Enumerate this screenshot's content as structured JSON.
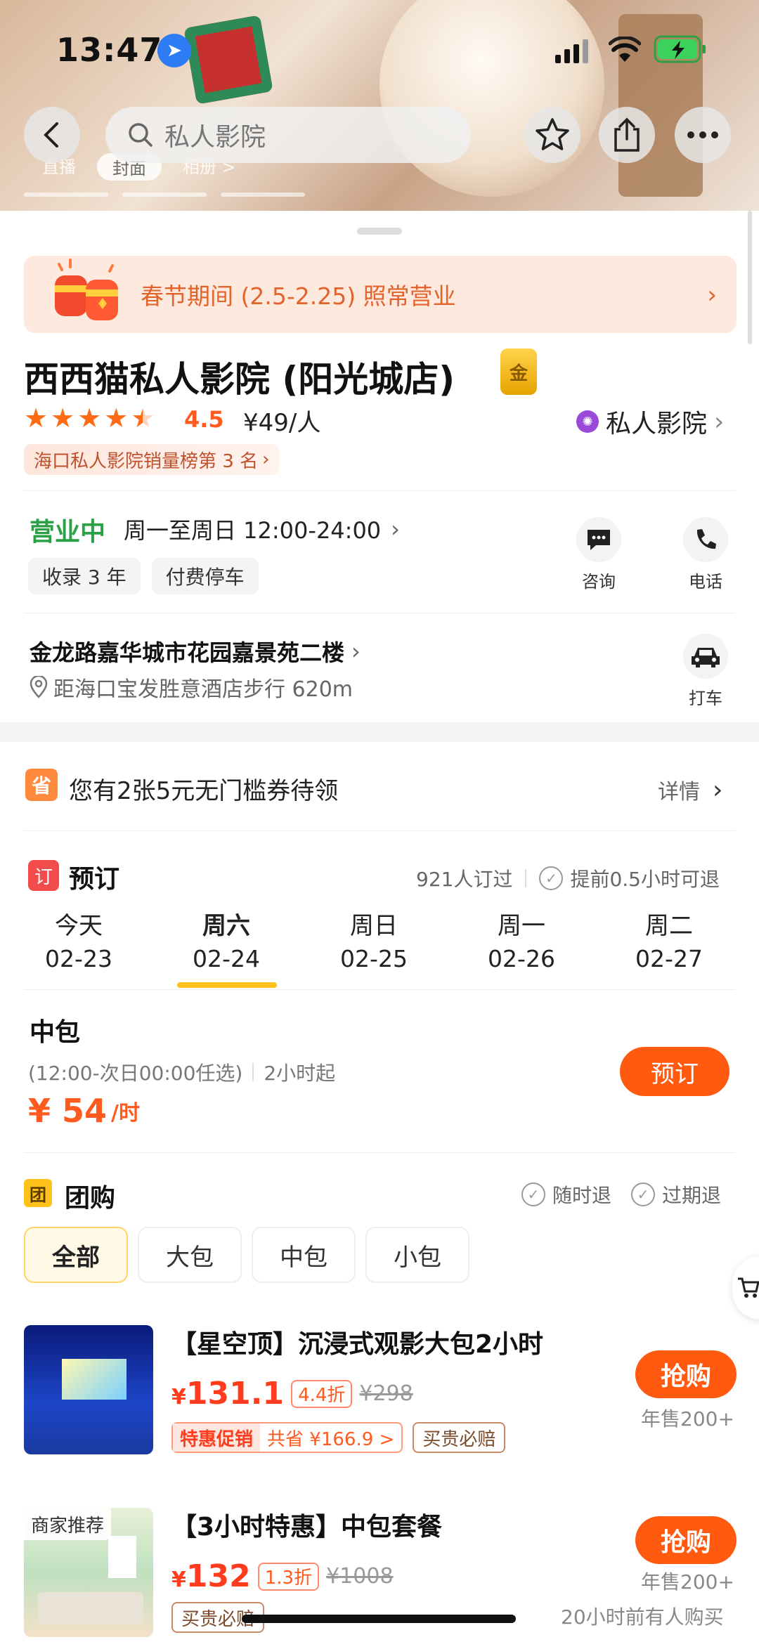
{
  "status_bar": {
    "time": "13:47"
  },
  "nav": {
    "search_placeholder": "私人影院"
  },
  "hero": {
    "tabs": [
      "直播",
      "封面",
      "相册 >"
    ]
  },
  "banner": {
    "text": "春节期间 (2.5-2.25) 照常营业"
  },
  "shop": {
    "name": "西西猫私人影院 (阳光城店)",
    "gold_badge": "金",
    "rating": "4.5",
    "rating_value": 4.5,
    "price_per_person": "¥49/人",
    "category": "私人影院",
    "rank": "海口私人影院销量榜第 3 名"
  },
  "hours": {
    "status": "营业中",
    "time": "周一至周日 12:00-24:00",
    "tags": [
      "收录 3 年",
      "付费停车"
    ],
    "actions": [
      {
        "label": "咨询",
        "icon": "chat-icon"
      },
      {
        "label": "电话",
        "icon": "phone-icon"
      }
    ]
  },
  "address": {
    "street": "金龙路嘉华城市花园嘉景苑二楼",
    "distance": "距海口宝发胜意酒店步行 620m",
    "taxi_label": "打车"
  },
  "coupon": {
    "icon_text": "省",
    "text": "您有2张5元无门槛券待领",
    "detail": "详情"
  },
  "booking": {
    "icon_text": "订",
    "title": "预订",
    "count": "921人订过",
    "advance": "提前0.5小时可退",
    "dates": [
      {
        "day": "今天",
        "date": "02-23"
      },
      {
        "day": "周六",
        "date": "02-24"
      },
      {
        "day": "周日",
        "date": "02-25"
      },
      {
        "day": "周一",
        "date": "02-26"
      },
      {
        "day": "周二",
        "date": "02-27"
      }
    ],
    "room": {
      "name": "中包",
      "range": "(12:00-次日00:00任选)",
      "min": "2小时起",
      "price": "¥ 54",
      "unit": "/时",
      "button": "预订"
    }
  },
  "group": {
    "icon_text": "团",
    "title": "团购",
    "refund1": "随时退",
    "refund2": "过期退",
    "filters": [
      "全部",
      "大包",
      "中包",
      "小包"
    ],
    "deals": [
      {
        "title": "【星空顶】沉浸式观影大包2小时",
        "price_symbol": "¥",
        "price": "131.1",
        "discount": "4.4折",
        "original": "¥298",
        "promo_a": "特惠促销",
        "promo_b": "共省 ¥166.9 >",
        "guarantee": "买贵必赔",
        "button": "抢购",
        "sold": "年售200+"
      },
      {
        "badge": "商家推荐",
        "title": "【3小时特惠】中包套餐",
        "price_symbol": "¥",
        "price": "132",
        "discount": "1.3折",
        "original": "¥1008",
        "guarantee": "买贵必赔",
        "button": "抢购",
        "sold": "年售200+",
        "recent": "20小时前有人购买"
      }
    ]
  }
}
